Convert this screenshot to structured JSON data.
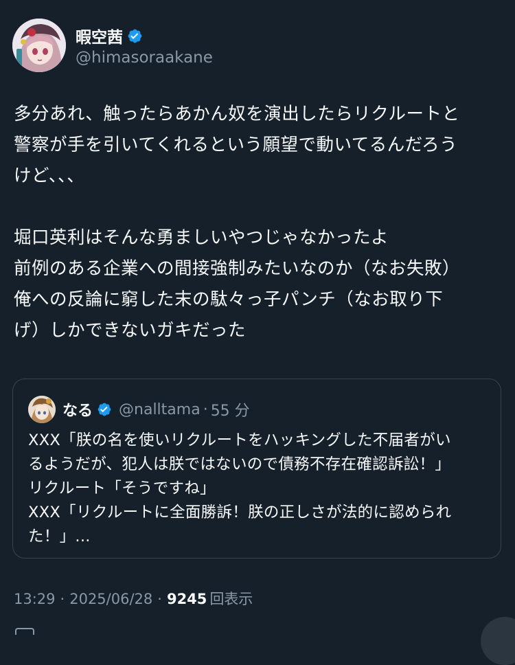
{
  "tweet": {
    "author": {
      "display_name": "暇空茜",
      "handle": "@himasoraakane",
      "verified": true,
      "avatar_icon": "anime-girl-avatar"
    },
    "text": "多分あれ、触ったらあかん奴を演出したらリクルートと\n警察が手を引いてくれるという願望で動いてるんだろう\nけど、、、\n\n堀口英利はそんな勇ましいやつじゃなかったよ\n前例のある企業への間接強制みたいなのか（なお失敗）\n俺への反論に窮した末の駄々っ子パンチ（なお取り下\nげ）しかできないガキだった",
    "quote": {
      "author": {
        "display_name": "なる",
        "handle": "@nalltama",
        "verified": true,
        "avatar_icon": "anime-character-avatar"
      },
      "separator": "·",
      "time": "55 分",
      "text": "XXX「朕の名を使いリクルートをハッキングした不届者がい\nるようだが、犯人は朕ではないので債務不存在確認訴訟！」\nリクルート「そうですね」\nXXX「リクルートに全面勝訴！朕の正しさが法的に認められ\nた！」..."
    },
    "meta": {
      "time": "13:29",
      "separator": "·",
      "date": "2025/06/28",
      "views_count": "9245",
      "views_label": "回表示"
    }
  },
  "colors": {
    "background": "#15202b",
    "text": "#f7f9f9",
    "secondary_text": "#8b98a5",
    "verified_badge": "#1d9bf0",
    "border": "#38444d"
  }
}
